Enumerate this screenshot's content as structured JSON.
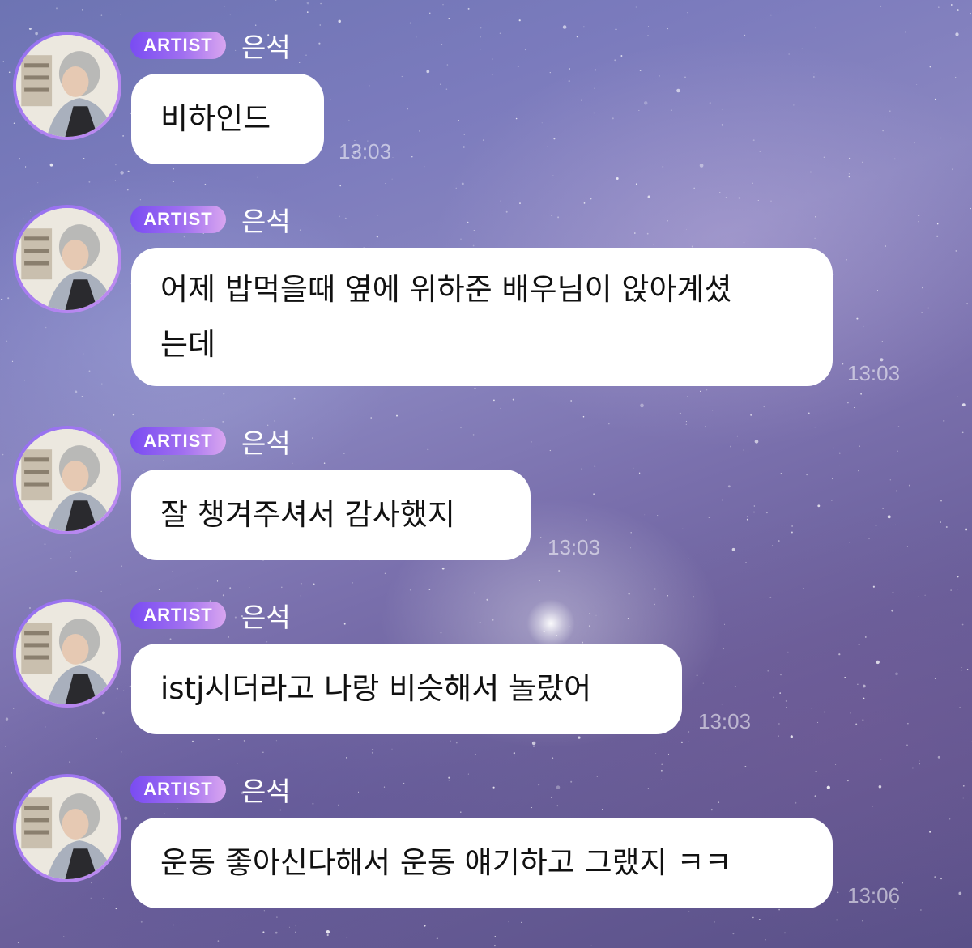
{
  "messages": [
    {
      "badge": "ARTIST",
      "sender": "은석",
      "text": "비하인드",
      "time": "13:03"
    },
    {
      "badge": "ARTIST",
      "sender": "은석",
      "text": "어제 밥먹을때 옆에 위하준 배우님이 앉아계셨\n는데",
      "time": "13:03"
    },
    {
      "badge": "ARTIST",
      "sender": "은석",
      "text": "잘 챙겨주셔서 감사했지",
      "time": "13:03"
    },
    {
      "badge": "ARTIST",
      "sender": "은석",
      "text": "istj시더라고 나랑 비슷해서 놀랐어",
      "time": "13:03"
    },
    {
      "badge": "ARTIST",
      "sender": "은석",
      "text": "운동 좋아신다해서 운동 얘기하고 그랬지 ㅋㅋ",
      "time": "13:06"
    }
  ],
  "colors": {
    "badge_start": "#7a4cf2",
    "badge_end": "#d9a6f0",
    "bubble": "#ffffff",
    "text": "#111111"
  },
  "icons": {
    "avatar": "avatar-photo"
  }
}
